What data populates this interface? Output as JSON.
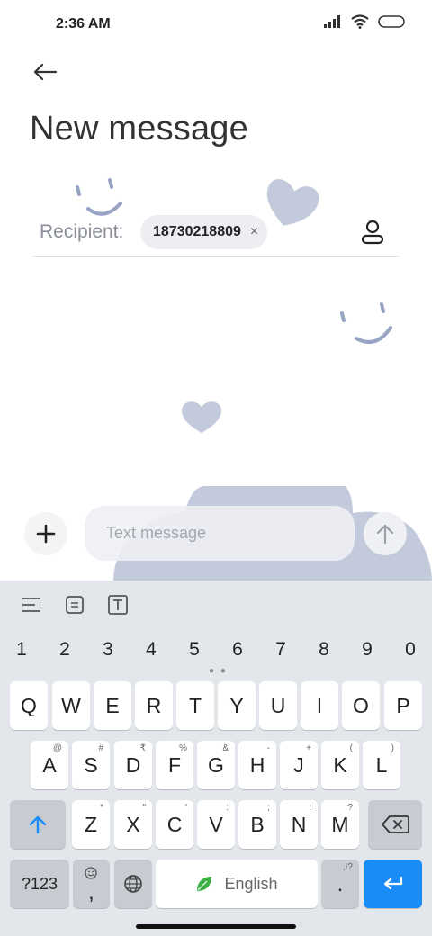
{
  "status_bar": {
    "time": "2:36 AM"
  },
  "header": {
    "title": "New message"
  },
  "recipient": {
    "label": "Recipient:",
    "chip_number": "18730218809",
    "chip_remove": "×"
  },
  "compose": {
    "placeholder": "Text message"
  },
  "keyboard": {
    "numbers": [
      "1",
      "2",
      "3",
      "4",
      "5",
      "6",
      "7",
      "8",
      "9",
      "0"
    ],
    "row1": [
      "Q",
      "W",
      "E",
      "R",
      "T",
      "Y",
      "U",
      "I",
      "O",
      "P"
    ],
    "row2": [
      "A",
      "S",
      "D",
      "F",
      "G",
      "H",
      "J",
      "K",
      "L"
    ],
    "row2_sup": [
      "@",
      "#",
      "₹",
      "",
      "%",
      "&",
      "-",
      "+",
      "(",
      ")"
    ],
    "row3": [
      "Z",
      "X",
      "C",
      "V",
      "B",
      "N",
      "M"
    ],
    "row3_sup": [
      "*",
      "\"",
      "'",
      ":",
      ";",
      "!",
      "?"
    ],
    "symbols_label": "?123",
    "comma_label": ",",
    "space_label": "English",
    "period_label": ".",
    "period_sup": ",!?"
  },
  "colors": {
    "accent": "#1a8cf7",
    "decoration": "#c3cadb",
    "decoration_line": "#97a4c4"
  }
}
